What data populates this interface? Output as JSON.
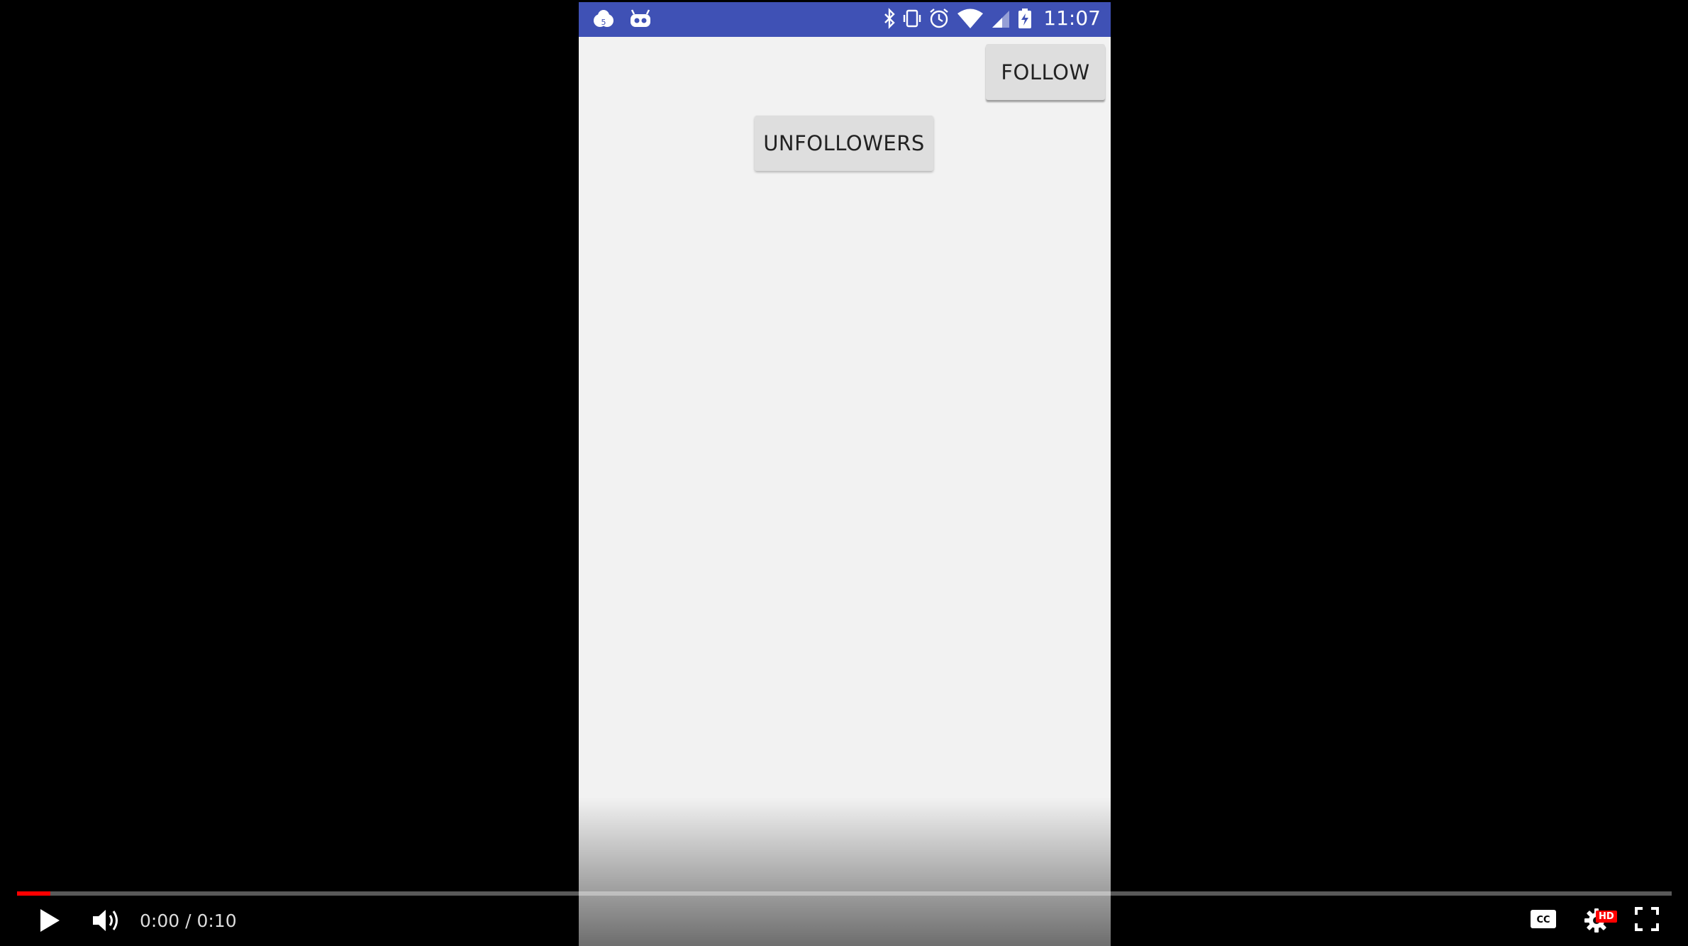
{
  "status_bar": {
    "time": "11:07",
    "left_icons": [
      "notification-cloud-icon",
      "android-bot-icon"
    ],
    "right_icons": [
      "bluetooth-icon",
      "vibrate-icon",
      "alarm-icon",
      "wifi-icon",
      "cellular-signal-icon",
      "battery-charging-icon"
    ],
    "color": "#3f51b5"
  },
  "app": {
    "follow_label": "FOLLOW",
    "unfollowers_label": "UNFOLLOWERS",
    "background": "#f2f2f2"
  },
  "player": {
    "time_display": "0:00 / 0:10",
    "progress_fraction": 0.02,
    "hd_badge": "HD",
    "accent_color": "#ff0000",
    "icons": [
      "play-icon",
      "volume-icon",
      "captions-icon",
      "settings-icon",
      "fullscreen-icon"
    ]
  }
}
